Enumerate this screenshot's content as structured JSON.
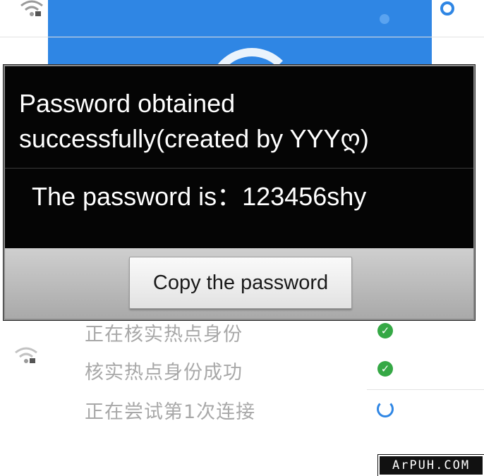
{
  "dialog": {
    "title": "Password obtained successfully(created by YYYღ)",
    "message": "The password is：123456shy",
    "copy_button_label": "Copy the password"
  },
  "background": {
    "steps": [
      {
        "label": "正在核实热点身份",
        "status": "check-icon"
      },
      {
        "label": "核实热点身份成功",
        "status": "check-icon"
      },
      {
        "label": "正在尝试第1次连接",
        "status": "spinner-icon"
      }
    ]
  },
  "watermark": {
    "text": "ArPUH.COM"
  },
  "colors": {
    "accent_blue": "#2f86e4",
    "success_green": "#35a845",
    "dialog_background": "#050505"
  }
}
